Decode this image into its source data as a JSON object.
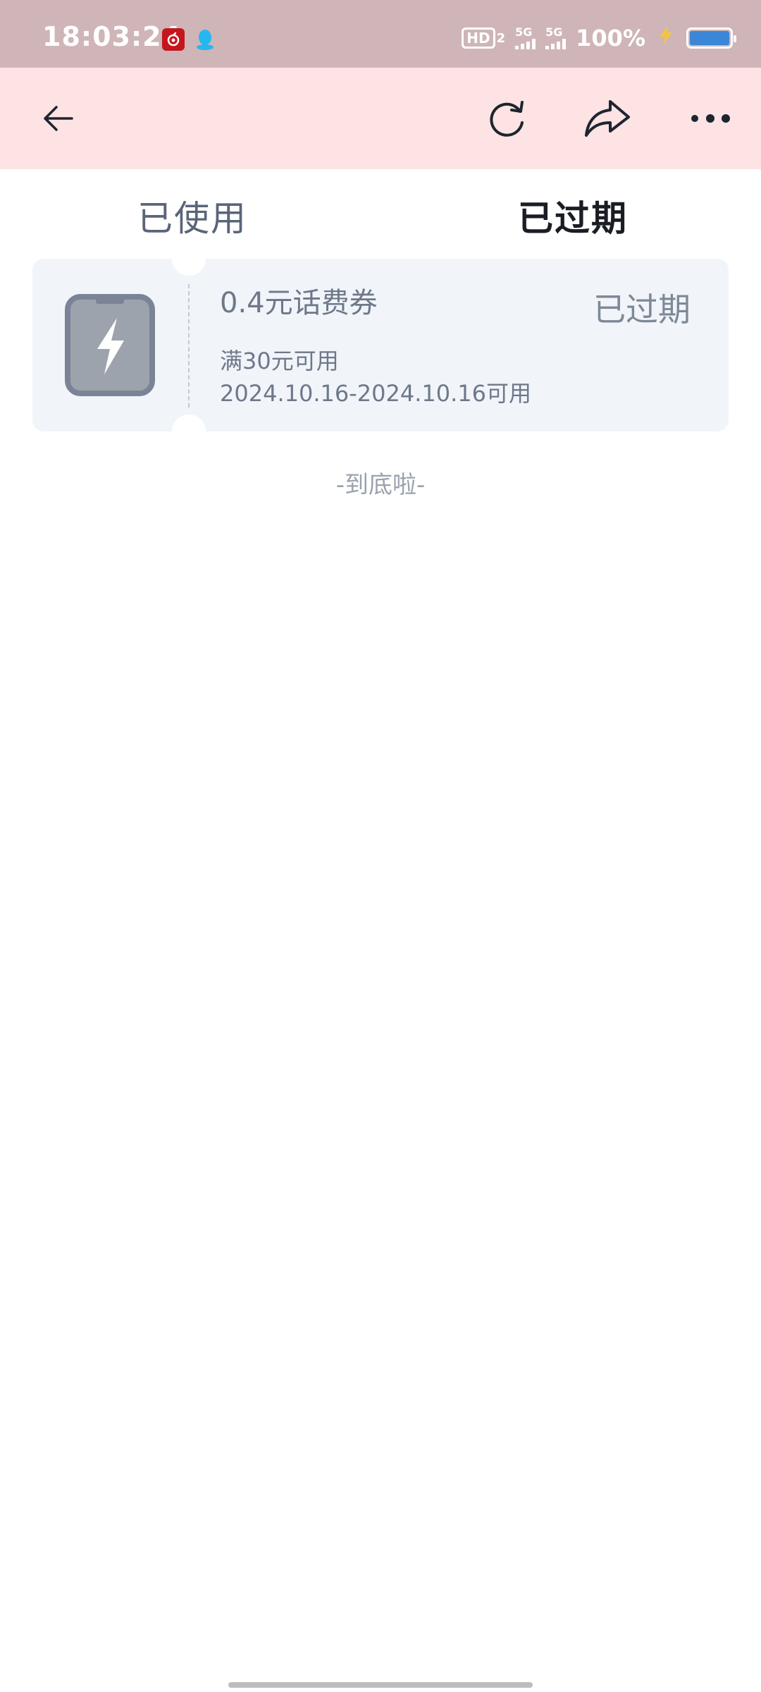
{
  "status_bar": {
    "time": "18:03:24",
    "hd_label": "HD",
    "hd_sub": "2",
    "signal_1": "5G",
    "signal_2": "5G",
    "battery_text": "100%",
    "icons": [
      "netease-music-icon",
      "qq-icon",
      "hd-icon",
      "signal-icon",
      "charging-icon",
      "battery-icon"
    ]
  },
  "nav": {
    "icons": [
      "back-arrow-icon",
      "refresh-icon",
      "share-icon",
      "more-icon"
    ]
  },
  "tabs": [
    {
      "label": "已使用",
      "active": false
    },
    {
      "label": "已过期",
      "active": true
    }
  ],
  "coupon": {
    "title": "0.4元话费券",
    "condition": "满30元可用",
    "validity": "2024.10.16-2024.10.16可用",
    "status": "已过期",
    "icon": "phone-charge-icon"
  },
  "end_of_list": "-到底啦-",
  "colors": {
    "status_bar_bg": "#cfb5b7",
    "nav_bg": "#fde3e3",
    "coupon_bg": "#f1f5fa",
    "battery_fill": "#3b86d6",
    "active_tab_text": "#1a1d24",
    "inactive_tab_text": "#5a6578",
    "muted_text": "#6e7889"
  }
}
